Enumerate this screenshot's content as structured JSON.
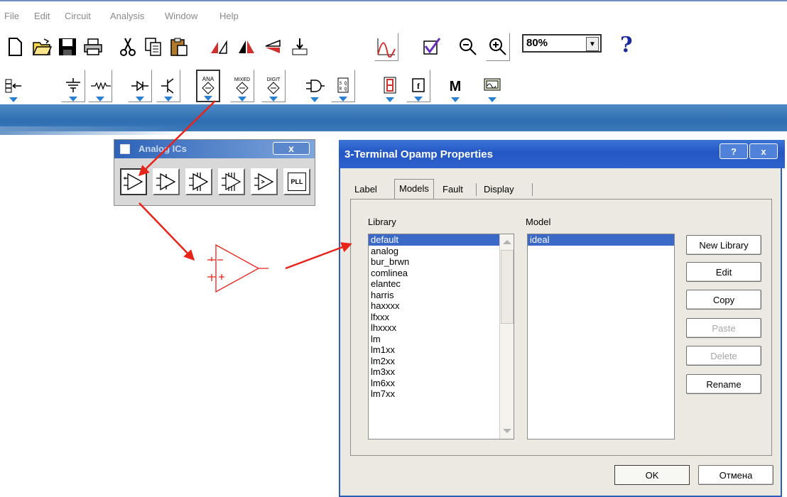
{
  "menu": {
    "items": [
      "File",
      "Edit",
      "Circuit",
      "Analysis",
      "Window",
      "Help"
    ]
  },
  "toolbar": {
    "zoom_value": "80%",
    "help_label": "?",
    "icons_row1": [
      "new-file-icon",
      "open-folder-icon",
      "save-icon",
      "print-icon",
      "cut-icon",
      "copy-icon",
      "paste-icon",
      "rotate-icon",
      "flip-horizontal-icon",
      "flip-vertical-icon",
      "component-properties-icon",
      "graph-icon",
      "check-icon",
      "zoom-out-icon",
      "zoom-in-icon"
    ],
    "icons_row2": [
      "probe-icon",
      "sources-icon",
      "basic-icon",
      "diodes-icon",
      "transistors-icon",
      "analog-ics-icon",
      "mixed-ics-icon",
      "digital-ics-icon",
      "logic-gates-icon",
      "digital-icon",
      "indicators-icon",
      "controls-icon",
      "miscellaneous-icon",
      "instruments-icon"
    ],
    "ana_label": "ANA",
    "mixed_label": "MIXED",
    "digit_label": "DIGIT",
    "m_label": "M",
    "f_label": "f"
  },
  "analog_window": {
    "title": "Analog ICs",
    "close_label": "x",
    "pll_label": "PLL"
  },
  "dialog": {
    "title": "3-Terminal Opamp Properties",
    "help_label": "?",
    "close_label": "x",
    "tabs": [
      "Label",
      "Models",
      "Fault",
      "Display"
    ],
    "active_tab": "Models",
    "library_label": "Library",
    "model_label": "Model",
    "library_items": [
      "default",
      "analog",
      "bur_brwn",
      "comlinea",
      "elantec",
      "harris",
      "haxxxx",
      "lfxxx",
      "lhxxxx",
      "lm",
      "lm1xx",
      "lm2xx",
      "lm3xx",
      "lm6xx",
      "lm7xx"
    ],
    "library_selected": "default",
    "model_items": [
      "ideal"
    ],
    "model_selected": "ideal",
    "buttons": {
      "new_library": "New Library",
      "edit": "Edit",
      "copy": "Copy",
      "paste": "Paste",
      "delete": "Delete",
      "rename": "Rename"
    },
    "ok": "OK",
    "cancel": "Отмена"
  },
  "colors": {
    "annotation_red": "#e8231a",
    "band_blue": "#2f6eb1",
    "selection_blue": "#3b69c8",
    "title_blue": "#2457c5"
  }
}
